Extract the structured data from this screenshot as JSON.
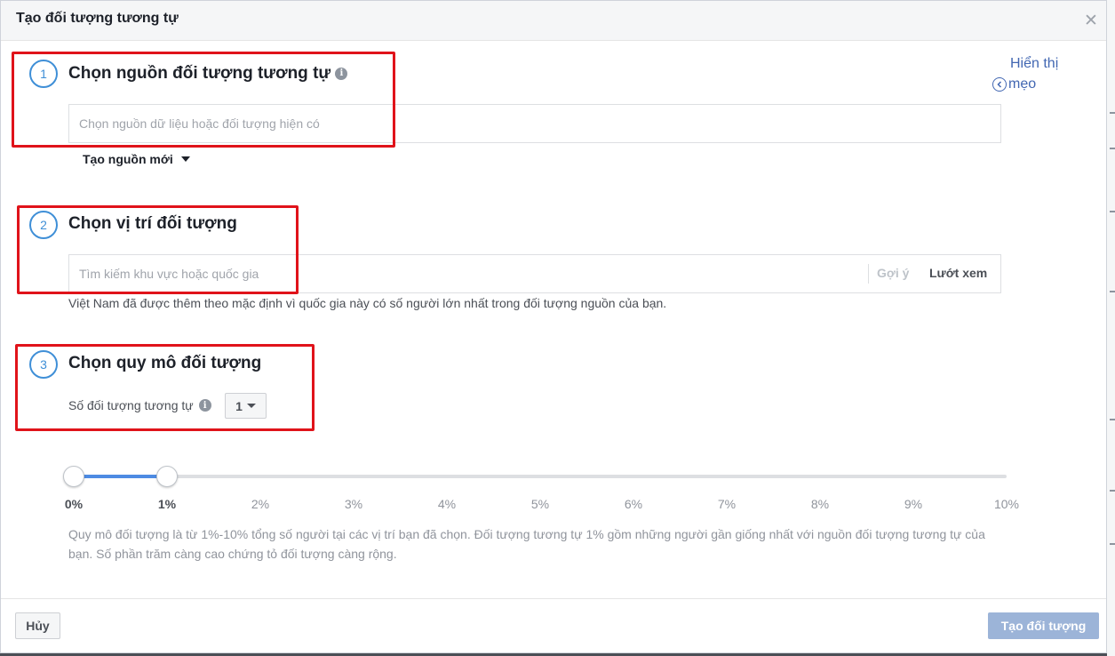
{
  "header": {
    "title": "Tạo đối tượng tương tự",
    "close_icon": "close-icon"
  },
  "tips": {
    "line1": "Hiển thị",
    "line2": "mẹo",
    "icon": "chevron-left-icon"
  },
  "step1": {
    "number": "1",
    "title": "Chọn nguồn đối tượng tương tự",
    "info_icon": "info-icon",
    "input_placeholder": "Chọn nguồn dữ liệu hoặc đối tượng hiện có",
    "new_source_label": "Tạo nguồn mới"
  },
  "step2": {
    "number": "2",
    "title": "Chọn vị trí đối tượng",
    "input_placeholder": "Tìm kiếm khu vực hoặc quốc gia",
    "suggest_label": "Gợi ý",
    "browse_label": "Lướt xem",
    "default_note": "Việt Nam đã được thêm theo mặc định vì quốc gia này có số người lớn nhất trong đối tượng nguồn của bạn."
  },
  "step3": {
    "number": "3",
    "title": "Chọn quy mô đối tượng",
    "count_label": "Số đối tượng tương tự",
    "count_value": "1",
    "slider": {
      "min_percent": 0,
      "max_percent": 10,
      "range_start_percent": 0,
      "range_end_percent": 1,
      "ticks": [
        "0%",
        "1%",
        "2%",
        "3%",
        "4%",
        "5%",
        "6%",
        "7%",
        "8%",
        "9%",
        "10%"
      ],
      "active_ticks": [
        "0%",
        "1%"
      ]
    },
    "description": "Quy mô đối tượng là từ 1%-10% tổng số người tại các vị trí bạn đã chọn. Đối tượng tương tự 1% gồm những người gần giống nhất với nguồn đối tượng tương tự của bạn. Số phần trăm càng cao chứng tỏ đối tượng càng rộng."
  },
  "footer": {
    "cancel_label": "Hủy",
    "create_label": "Tạo đối tượng"
  },
  "colors": {
    "highlight_box": "#e0131a",
    "step_circle": "#3f8fd7",
    "link": "#4267b2",
    "slider_fill": "#4d8be3",
    "create_button_disabled": "#9cb4d8"
  }
}
